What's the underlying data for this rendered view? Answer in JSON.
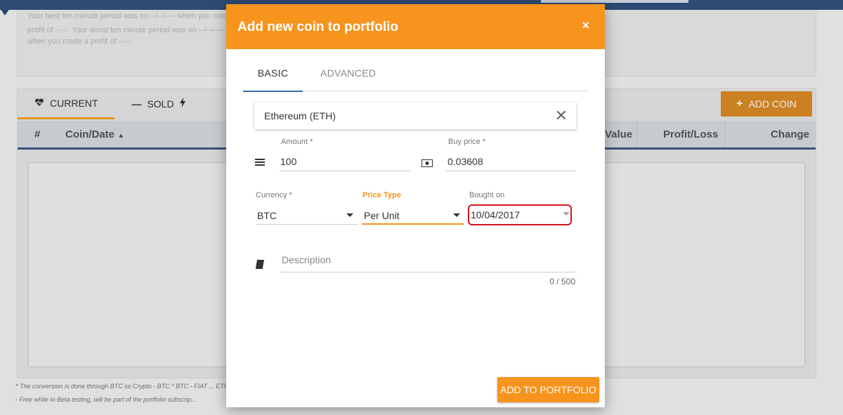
{
  "background": {
    "summary_lines": [
      "Your best ten minute period was on --/--/---- when you made a",
      "profit of --.--. Your worst ten minute period was on --/--/----",
      "when you made a profit of --.--."
    ],
    "tabs": [
      {
        "label": "CURRENT",
        "icon": "heartbeat-icon"
      },
      {
        "label": "SOLD",
        "icon": "minus-icon",
        "suffix_icon": "bolt-icon"
      }
    ],
    "add_coin_label": "ADD COIN",
    "table_headers": [
      "#",
      "Coin/Date",
      "Value",
      "Profit/Loss",
      "Change"
    ],
    "footnotes": [
      "* The conversion is done through BTC so Crypto - BTC * BTC - FIAT ... ETH is DASH - BTC / ETH - BTC)",
      "- Free while in Beta testing, will be part of the portfolio subscrip..."
    ]
  },
  "modal": {
    "title": "Add new coin to portfolio",
    "close_symbol": "×",
    "tabs": [
      "BASIC",
      "ADVANCED"
    ],
    "active_tab": "BASIC",
    "coin": "Ethereum (ETH)",
    "amount": {
      "label": "Amount *",
      "value": "100"
    },
    "buy_price": {
      "label": "Buy price *",
      "value": "0.03608"
    },
    "currency": {
      "label": "Currency *",
      "value": "BTC"
    },
    "price_type": {
      "label": "Price Type",
      "value": "Per Unit"
    },
    "bought_on": {
      "label": "Bought on",
      "value": "10/04/2017"
    },
    "description": {
      "placeholder": "Description",
      "counter": "0 / 500"
    },
    "submit_label": "ADD TO PORTFOLIO"
  },
  "colors": {
    "accent": "#f7941d",
    "nav": "#2c4a73",
    "highlight": "#d0141e"
  }
}
